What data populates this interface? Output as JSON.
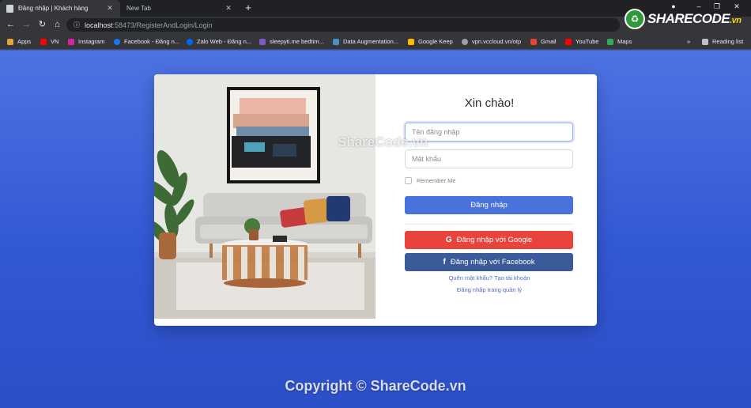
{
  "browser": {
    "tabs": [
      {
        "title": "Đăng nhập | Khách hàng",
        "active": true
      },
      {
        "title": "New Tab",
        "active": false
      }
    ],
    "new_tab_symbol": "+",
    "url_host": "localhost",
    "url_path": ":58473/RegisterAndLogin/Login",
    "bookmarks": [
      {
        "label": "Apps",
        "icon": "apps-grid-icon",
        "color": "#e8a33a"
      },
      {
        "label": "VN",
        "icon": "youtube-icon",
        "color": "#ff0000"
      },
      {
        "label": "Instagram",
        "icon": "instagram-icon",
        "color": "#d6249f"
      },
      {
        "label": "Facebook - Đăng n...",
        "icon": "facebook-icon",
        "color": "#1877f2"
      },
      {
        "label": "Zalo Web - Đăng n...",
        "icon": "zalo-icon",
        "color": "#0068ff"
      },
      {
        "label": "sleepyti.me bedtim...",
        "icon": "sleepytime-icon",
        "color": "#7a5cc2"
      },
      {
        "label": "Data Augmentation...",
        "icon": "data-icon",
        "color": "#4a90c2"
      },
      {
        "label": "Google Keep",
        "icon": "keep-icon",
        "color": "#fbbc04"
      },
      {
        "label": "vpn.vccloud.vn/otp",
        "icon": "globe-icon",
        "color": "#9aa0a6"
      },
      {
        "label": "Gmail",
        "icon": "gmail-icon",
        "color": "#ea4335"
      },
      {
        "label": "YouTube",
        "icon": "youtube-icon",
        "color": "#ff0000"
      },
      {
        "label": "Maps",
        "icon": "maps-icon",
        "color": "#34a853"
      }
    ],
    "overflow_symbol": "»",
    "reading_list": "Reading list"
  },
  "logo": {
    "text": "SHARECODE",
    "suffix": ".vn"
  },
  "login": {
    "heading": "Xin chào!",
    "username_placeholder": "Tên đăng nhập",
    "password_placeholder": "Mật khẩu",
    "remember_label": "Remember Me",
    "login_button": "Đăng nhập",
    "google_button": "Đăng nhập với Google",
    "facebook_button": "Đăng nhập với Facebook",
    "forgot_link": "Quên mật khẩu? Tạo tài khoản",
    "admin_link": "Đăng nhập trang quản lý"
  },
  "watermark": "ShareCode.vn",
  "copyright": "Copyright © ShareCode.vn",
  "colors": {
    "page_bg": "#3a5ed6",
    "login_button": "#4a72dc",
    "google_button": "#e8443b",
    "facebook_button": "#3b5a99",
    "link": "#4b6fd3"
  }
}
